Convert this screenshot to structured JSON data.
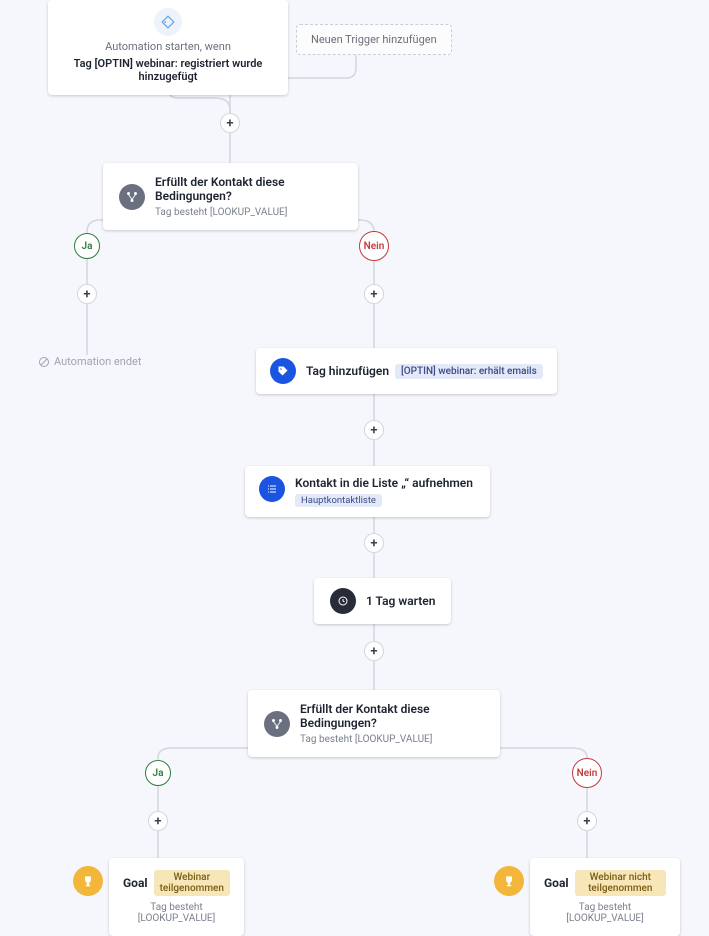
{
  "trigger": {
    "prompt": "Automation starten, wenn",
    "label": "Tag [OPTIN] webinar: registriert wurde hinzugefügt",
    "add_new": "Neuen Trigger hinzufügen"
  },
  "condition1": {
    "title": "Erfüllt der Kontakt diese Bedingungen?",
    "sub": "Tag besteht [LOOKUP_VALUE]"
  },
  "branches": {
    "yes": "Ja",
    "no": "Nein"
  },
  "end_label": "Automation endet",
  "add_tag": {
    "label": "Tag hinzufügen",
    "chip": "[OPTIN] webinar: erhält emails"
  },
  "add_list": {
    "label": "Kontakt in die Liste „“ aufnehmen",
    "chip": "Hauptkontaktliste"
  },
  "wait": {
    "label": "1 Tag warten"
  },
  "condition2": {
    "title": "Erfüllt der Kontakt diese Bedingungen?",
    "sub": "Tag besteht [LOOKUP_VALUE]"
  },
  "goal_yes": {
    "label": "Goal",
    "chip": "Webinar teilgenommen",
    "sub": "Tag besteht [LOOKUP_VALUE]"
  },
  "goal_no": {
    "label": "Goal",
    "chip": "Webinar nicht teilgenommen",
    "sub": "Tag besteht [LOOKUP_VALUE]"
  }
}
